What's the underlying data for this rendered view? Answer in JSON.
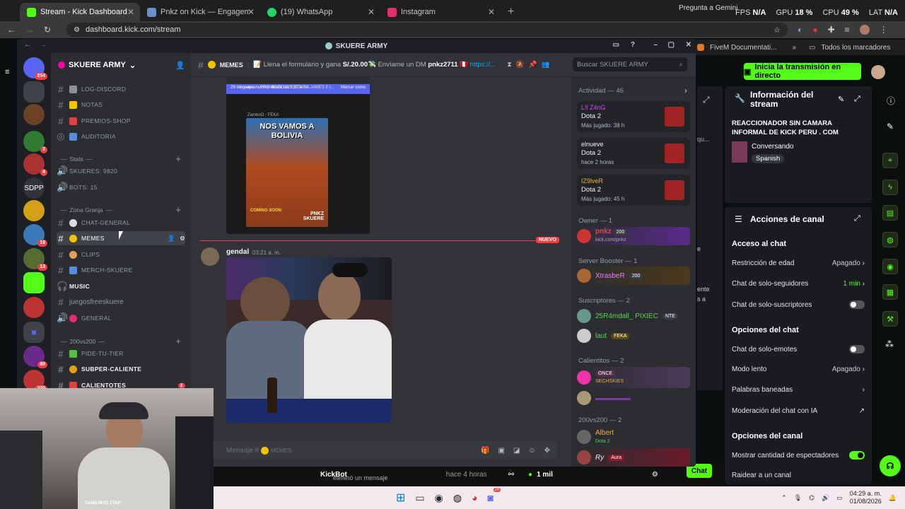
{
  "browser": {
    "tabs": [
      {
        "label": "Stream - Kick Dashboard",
        "active": true,
        "color": "#53fc18"
      },
      {
        "label": "Pnkz on Kick — Engagement A",
        "active": false,
        "color": "#6b8fc9"
      },
      {
        "label": "(19) WhatsApp",
        "active": false,
        "color": "#25d366"
      },
      {
        "label": "Instagram",
        "active": false,
        "color": "#e1306c"
      }
    ],
    "url": "dashboard.kick.com/stream",
    "gemini": "Pregunta a Gemini",
    "stats": {
      "fps_label": "FPS",
      "fps": "N/A",
      "gpu_label": "GPU",
      "gpu": "18 %",
      "cpu_label": "CPU",
      "cpu": "49 %",
      "lat_label": "LAT",
      "lat": "N/A"
    },
    "bookmarks": {
      "fivem": "FiveM Documentati...",
      "all": "Todos los marcadores"
    }
  },
  "kick": {
    "start_stream": "Inicia la transmisión en directo",
    "info_title": "Información del stream",
    "stream_title": "REACCIONADOR SIN CAMARA INFORMAL DE KICK PERU . COM",
    "category": "Conversando",
    "language": "Spanish",
    "actions_title": "Acciones de canal",
    "chat_access": "Acceso al chat",
    "age_restriction": "Restricción de edad",
    "age_value": "Apagado",
    "followers_only": "Chat de solo-seguidores",
    "followers_value": "1 min",
    "subs_only": "Chat de solo-suscriptores",
    "chat_options": "Opciones del chat",
    "emotes_only": "Chat de solo-emotes",
    "slow_mode": "Modo lento",
    "slow_value": "Apagado",
    "banned_words": "Palabras baneadas",
    "ai_moderation": "Moderación del chat con IA",
    "channel_options": "Opciones del canal",
    "show_viewers": "Mostrar cantidad de espectadores",
    "raid": "Raidear a un canal",
    "bottom": {
      "user": "KickBot",
      "text": "eliminó un mensaje",
      "time": "hace 4 horas",
      "viewers": "1 mil",
      "chat": "Chat"
    },
    "partial": {
      "a": "qu...",
      "b": "e",
      "c": "ente",
      "d": "s a",
      "e": "a"
    }
  },
  "discord": {
    "window_title": "SKUERE ARMY",
    "server_name": "SKUERE ARMY",
    "channels": [
      {
        "name": "LOG-DISCORD",
        "type": "text",
        "emoji_color": "#8e9297"
      },
      {
        "name": "NOTAS",
        "type": "text",
        "emoji_color": "#f5c400"
      },
      {
        "name": "PREMIOS-SHOP",
        "type": "text",
        "emoji_color": "#e04040"
      },
      {
        "name": "AUDITORIA",
        "type": "forum",
        "emoji_color": "#5b8dd9"
      }
    ],
    "stats_category": "Stats",
    "stat_channels": [
      {
        "name": "SKUERES: 9820"
      },
      {
        "name": "BOTS: 15"
      }
    ],
    "zona_category": "Zona Granja",
    "zona_channels": [
      {
        "name": "CHAT-GENERAL",
        "selected": false,
        "bright": false
      },
      {
        "name": "MEMES",
        "selected": true,
        "bright": true
      },
      {
        "name": "CLIPS",
        "selected": false,
        "bright": false
      },
      {
        "name": "MERCH-SKUERE",
        "selected": false,
        "bright": false
      },
      {
        "name": "MUSIC",
        "selected": false,
        "bright": true
      },
      {
        "name": "juegosfreeskuere",
        "selected": false,
        "bright": false
      },
      {
        "name": "GENERAL",
        "selected": false,
        "bright": false
      }
    ],
    "cat200": "200vs200",
    "cat200_channels": [
      {
        "name": "PIDE-TU-TIER",
        "bright": false
      },
      {
        "name": "SUBPER-CALIENTE",
        "bright": true
      },
      {
        "name": "CALIENTOTES",
        "bright": true
      }
    ],
    "server_badges": [
      "254",
      "2",
      "4",
      "19",
      "13",
      "89",
      "200"
    ],
    "server_text": "SDPP",
    "header": {
      "channel": "MEMES",
      "topic_a": "Llena el formulario y gana",
      "topic_amount": "S/.20.00",
      "topic_b": "Envíame un DM",
      "topic_user": "pnkz2711",
      "topic_link": "https://..."
    },
    "search_placeholder": "Buscar SKUERE ARMY",
    "embed": {
      "poster_title": "NOS VAMOS A BOLIVIA",
      "poster_sub": "COMING SOON",
      "poster_author": "PNKZ SKUERE",
      "embed_channel": "# general",
      "embed_rule": "PROHIBIDO INSULTAR A JAMES E I...",
      "embed_new": "29 mensajes nuevos desde las 3:21 a. m.",
      "embed_mark": "Marcar como",
      "poster_user": "ZamboO",
      "poster_tag": "FEKA"
    },
    "new_label": "NUEVO",
    "message": {
      "author": "gendal",
      "time": "03:21 a. m."
    },
    "input_placeholder": "Mensaje #",
    "input_channel": "MEMES",
    "members": {
      "activity_header": "Actividad — 46",
      "activities": [
        {
          "user": "L!l Z4nG",
          "game": "Dota 2",
          "status": "Más jugado: 38 h"
        },
        {
          "user": "elnueve",
          "game": "Dota 2",
          "status": "hace 2 horas"
        },
        {
          "user": "IZ9lveR",
          "game": "Dota 2",
          "status": "Más jugado: 45 h"
        }
      ],
      "owner_header": "Owner — 1",
      "owner": {
        "name": "pnkz",
        "badge": "200",
        "sub": "kick.com/pnkz"
      },
      "booster_header": "Server Booster — 1",
      "booster": {
        "name": "XtrasbeR",
        "badge": "200"
      },
      "subs_header": "Suscriptores — 2",
      "subs": [
        {
          "name": "25R4mdall_ PIXIEC",
          "tag": "NTE"
        },
        {
          "name": "laut",
          "tag": "FEKA"
        }
      ],
      "calientitos_header": "Calientitos — 2",
      "calientitos": [
        {
          "tag": "ONCE",
          "sub": "SECHSKIES"
        }
      ],
      "vs_header": "200vs200 — 2",
      "vs": [
        {
          "name": "Albert",
          "sub": "Dota 2"
        },
        {
          "name": "Ry",
          "tag": "Aura"
        }
      ]
    }
  },
  "taskbar": {
    "time": "04:29 a. m.",
    "date": "01/08/2026",
    "chat_badge": "26"
  },
  "webcam": {
    "name": "SAMB MOD STAR"
  }
}
